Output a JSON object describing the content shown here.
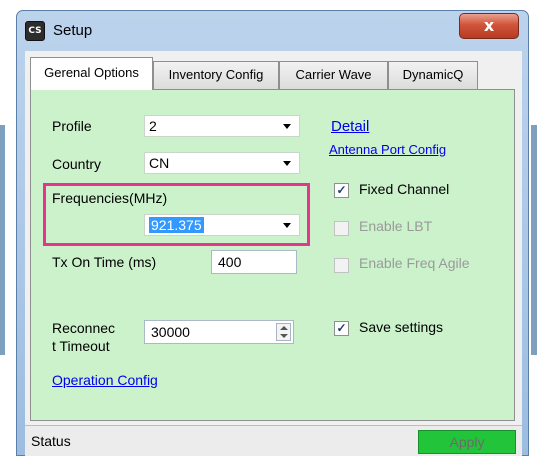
{
  "window": {
    "title": "Setup",
    "icon_text": "CS",
    "close_glyph": "x"
  },
  "tabs": [
    {
      "label": "Gerenal Options",
      "active": true
    },
    {
      "label": "Inventory Config",
      "active": false
    },
    {
      "label": "Carrier Wave",
      "active": false
    },
    {
      "label": "DynamicQ",
      "active": false
    }
  ],
  "general": {
    "profile_label": "Profile",
    "profile_value": "2",
    "country_label": "Country",
    "country_value": "CN",
    "frequencies_label": "Frequencies(MHz)",
    "frequency_value": "921.375",
    "tx_on_time_label": "Tx On Time (ms)",
    "tx_on_time_value": "400",
    "reconnect_label_line1": "Reconnec",
    "reconnect_label_line2": "t Timeout",
    "reconnect_value": "30000",
    "operation_config_link": "Operation Config",
    "detail_link": "Detail",
    "antenna_port_link": "Antenna Port Config",
    "fixed_channel_label": "Fixed Channel",
    "fixed_channel_checked": true,
    "enable_lbt_label": "Enable LBT",
    "enable_lbt_checked": false,
    "enable_freq_agile_label": "Enable Freq Agile",
    "enable_freq_agile_checked": false,
    "save_settings_label": "Save settings",
    "save_settings_checked": true
  },
  "statusbar": {
    "status_text": "Status",
    "apply_label": "Apply"
  },
  "colors": {
    "panel_bg": "#ccf2cc",
    "highlight_border": "#e4368e",
    "apply_bg": "#22c43a",
    "link": "#0000ee",
    "close_button": "#c7462c"
  },
  "icons": {
    "check_glyph": "✓"
  }
}
